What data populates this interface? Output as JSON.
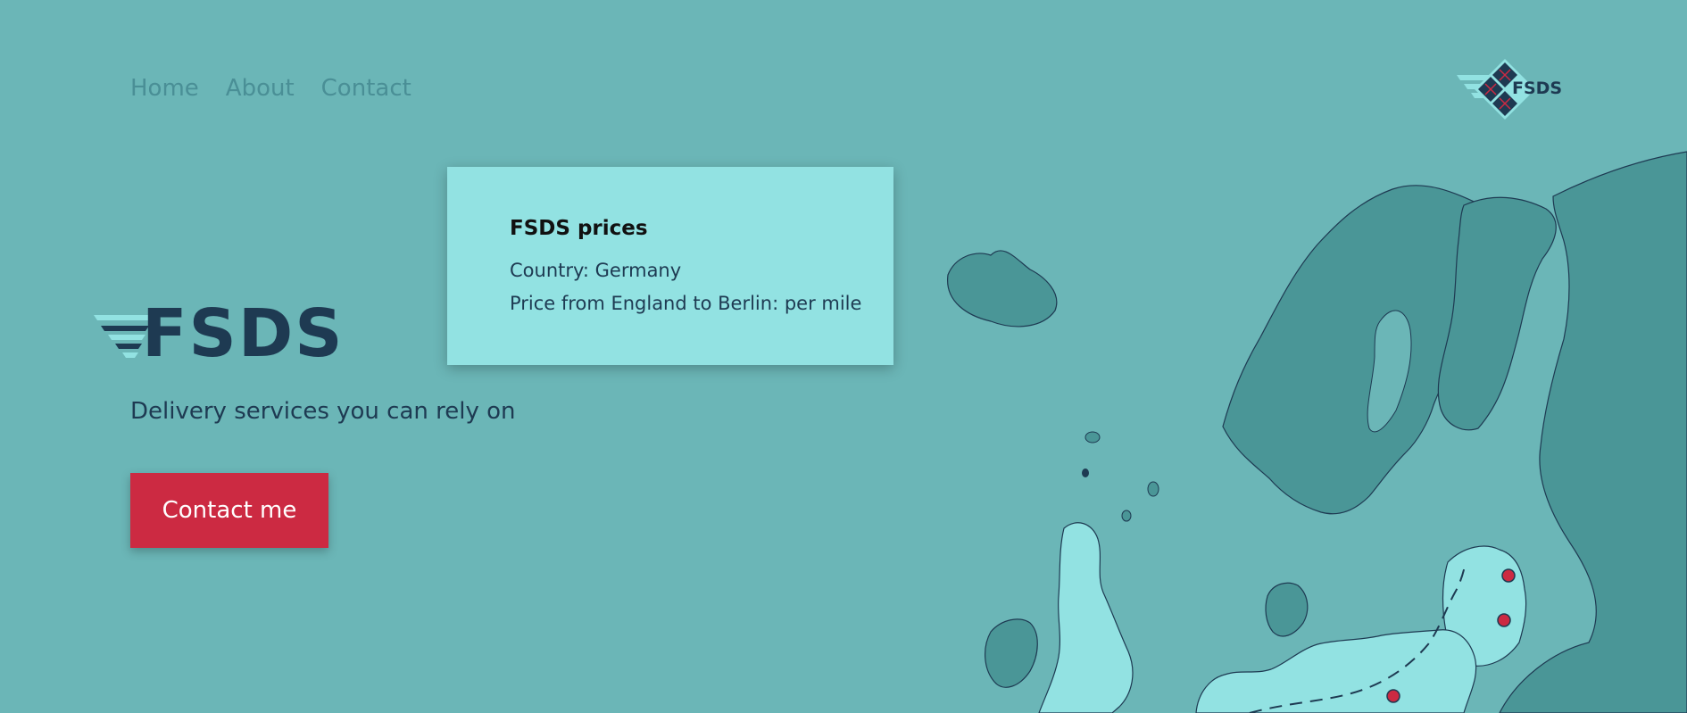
{
  "nav": {
    "items": [
      {
        "label": "Home"
      },
      {
        "label": "About"
      },
      {
        "label": "Contact"
      }
    ]
  },
  "brand": {
    "badge_text": "FSDS",
    "logo_text": "FSDS"
  },
  "hero": {
    "tagline": "Delivery services you can rely on",
    "cta_label": "Contact me"
  },
  "price_card": {
    "title": "FSDS prices",
    "country_line": "Country: Germany",
    "price_line": "Price from England to Berlin: per mile"
  },
  "colors": {
    "background": "#6bb6b7",
    "brand_navy": "#1e3a52",
    "accent_red": "#cc2a42",
    "card_bg": "#92e2e2",
    "map_dark": "#4a9697",
    "map_light": "#92e2e2"
  },
  "icons": {
    "badge": "fsds-diamond-logo-icon",
    "logo_stripes": "speed-stripes-icon",
    "map": "europe-map",
    "route_pin": "location-pin-icon"
  }
}
